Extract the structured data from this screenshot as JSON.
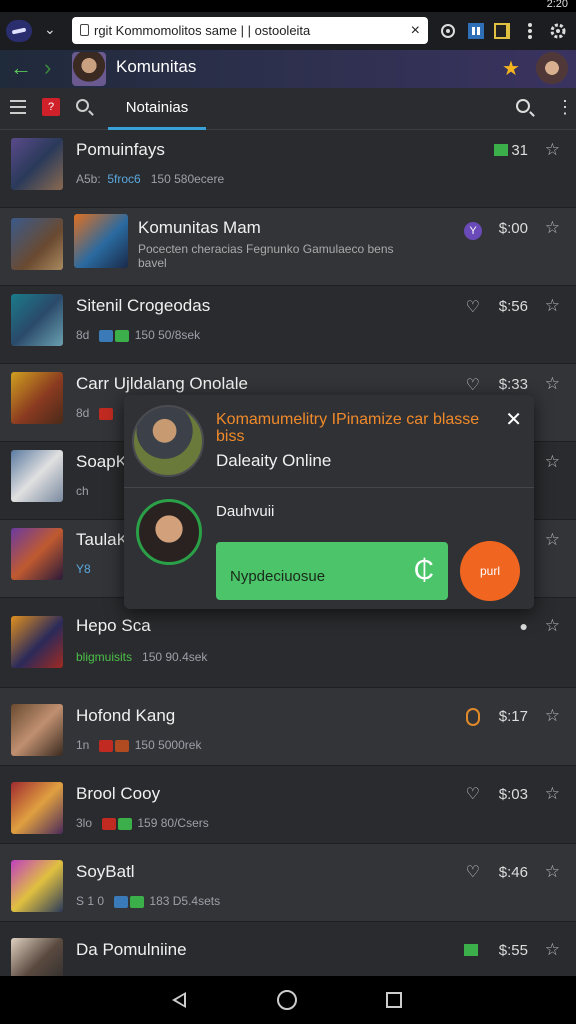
{
  "status": {
    "time": "2:20"
  },
  "browser": {
    "url": "rgit Kommomolitos same | | ostooleita"
  },
  "app": {
    "title": "Komunitas"
  },
  "toolbar": {
    "tab_label": "Notainias",
    "badge": "?"
  },
  "rows": [
    {
      "name": "Pomuinfays",
      "meta_a": "A5b:",
      "meta_tag": "5froc6",
      "meta_b": "150 580ecere",
      "price": "31"
    },
    {
      "name": "Komunitas Mam",
      "desc": "Pocecten cheracias Fegnunko Gamulaeco bens bavel",
      "price": "$:00"
    },
    {
      "name": "Sitenil Crogeodas",
      "meta_a": "8d",
      "meta_b": "150 50/8sek",
      "price": "$:56"
    },
    {
      "name": "Carr Ujldalang Onolale",
      "meta_a": "8d",
      "price": "$:33"
    },
    {
      "name": "SoapK",
      "meta_a": "ch"
    },
    {
      "name": "TaulaK",
      "meta_a": "Y8"
    },
    {
      "name": "Hepo Sca",
      "meta_tag": "bligmuisits",
      "meta_b": "150 90.4sek"
    },
    {
      "name": "Hofond Kang",
      "meta_a": "1n",
      "meta_b": "150 5000rek",
      "price": "$:17"
    },
    {
      "name": "Brool Cooy",
      "meta_a": "3lo",
      "meta_b": "159 80/Csers",
      "price": "$:03"
    },
    {
      "name": "SoyBatl",
      "meta_a": "S 1 0",
      "meta_b": "183 D5.4sets",
      "price": "$:46"
    },
    {
      "name": "Da Pomulniine",
      "price": "$:55"
    }
  ],
  "popup": {
    "title": "Komamumelitry IPinamize car blasse biss",
    "subtitle": "Daleaity Online",
    "user_name": "Dauhvuii",
    "primary_button": "Nypdeciuosue",
    "orange_button": "purl"
  },
  "colors": {
    "accent_blue": "#3aa0d8",
    "accent_green": "#4bc46a",
    "accent_orange": "#f06520",
    "title_orange": "#f08a2a"
  }
}
